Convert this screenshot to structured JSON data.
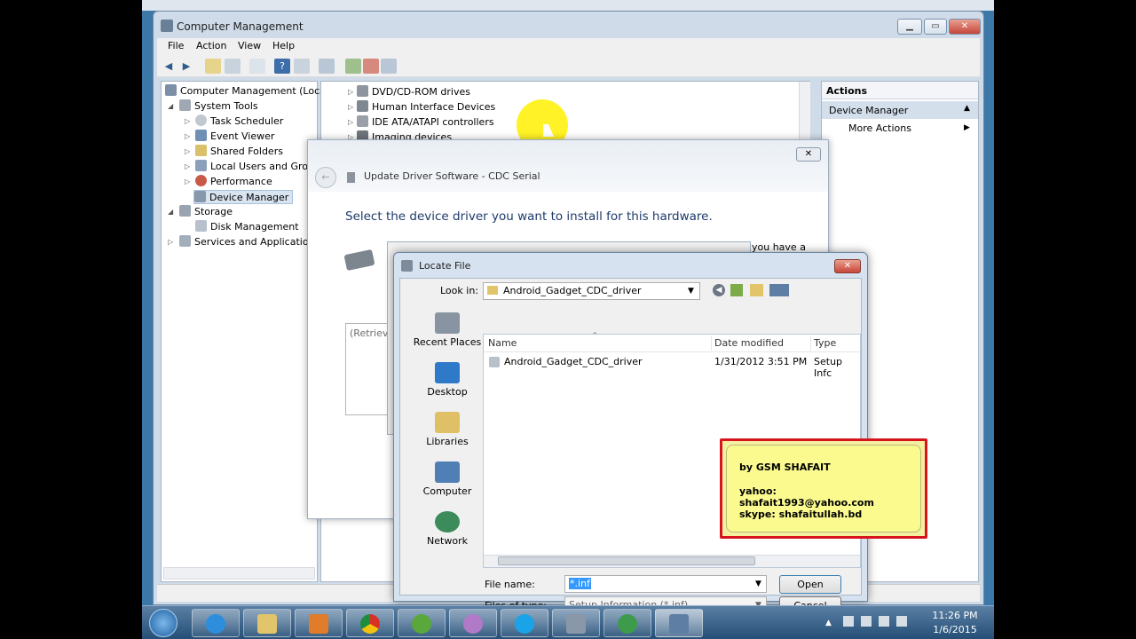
{
  "computer_management": {
    "title": "Computer Management",
    "menu": [
      "File",
      "Action",
      "View",
      "Help"
    ],
    "tree": [
      {
        "label": "Computer Management (Local"
      },
      {
        "label": "System Tools"
      },
      {
        "label": "Task Scheduler"
      },
      {
        "label": "Event Viewer"
      },
      {
        "label": "Shared Folders"
      },
      {
        "label": "Local Users and Group"
      },
      {
        "label": "Performance"
      },
      {
        "label": "Device Manager"
      },
      {
        "label": "Storage"
      },
      {
        "label": "Disk Management"
      },
      {
        "label": "Services and Applications"
      }
    ],
    "devices": [
      "DVD/CD-ROM drives",
      "Human Interface Devices",
      "IDE ATA/ATAPI controllers",
      "Imaging devices"
    ],
    "actions": {
      "header": "Actions",
      "section": "Device Manager",
      "more": "More Actions"
    }
  },
  "update_driver": {
    "title": "Update Driver Software - CDC Serial",
    "heading": "Select the device driver you want to install for this hardware.",
    "side_text": "you have a",
    "retrieving": "(Retrievi"
  },
  "locate_file": {
    "title": "Locate File",
    "look_in_label": "Look in:",
    "look_in_value": "Android_Gadget_CDC_driver",
    "places": [
      "Recent Places",
      "Desktop",
      "Libraries",
      "Computer",
      "Network"
    ],
    "columns": [
      "Name",
      "Date modified",
      "Type"
    ],
    "files": [
      {
        "name": "Android_Gadget_CDC_driver",
        "date": "1/31/2012 3:51 PM",
        "type": "Setup Infc"
      }
    ],
    "file_name_label": "File name:",
    "file_name_value": "*.inf",
    "files_of_type_label": "Files of type:",
    "files_of_type_value": "Setup Information (*.inf)",
    "open": "Open",
    "cancel": "Cancel"
  },
  "note": {
    "line1": "by GSM SHAFAIT",
    "line2": "yahoo: shafait1993@yahoo.com",
    "line3": "skype: shafaitullah.bd"
  },
  "clock": {
    "time": "11:26 PM",
    "date": "1/6/2015"
  }
}
